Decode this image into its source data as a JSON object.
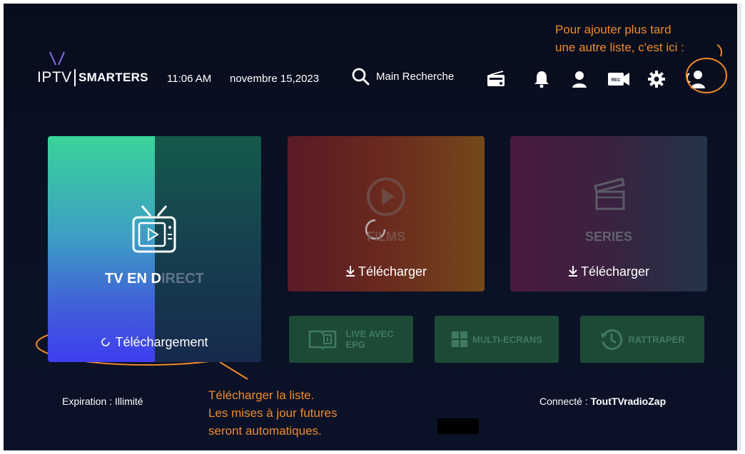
{
  "header": {
    "logo_left": "IPTV",
    "logo_right": "SMARTERS",
    "time": "11:06 AM",
    "date": "novembre 15,2023",
    "search_label": "Main Recherche",
    "icons": [
      "radio-icon",
      "bell-icon",
      "profile-icon",
      "record-icon",
      "gear-icon",
      "switch-user-icon"
    ],
    "record_text": "REC"
  },
  "cards": {
    "live": {
      "title_a": "TV EN D",
      "title_b": "IRECT",
      "status": "Téléchargement"
    },
    "films": {
      "label": "FILMS",
      "action": "Télécharger"
    },
    "series": {
      "label": "SERIES",
      "action": "Télécharger"
    },
    "epg": {
      "line1": "LIVE AVEC",
      "line2": "EPG"
    },
    "multi": {
      "label": "MULTI-ECRANS"
    },
    "catchup": {
      "label": "RATTRAPER"
    }
  },
  "footer": {
    "expiration": "Expiration : Illimité",
    "connected_label": "Connecté :",
    "connected_value": "ToutTVradioZap"
  },
  "annotations": {
    "top_line1": "Pour ajouter plus tard",
    "top_line2": "une autre liste, c'est ici :",
    "bottom_line1": "Télécharger la liste.",
    "bottom_line2": "Les mises à jour futures",
    "bottom_line3": "seront automatiques."
  },
  "colors": {
    "annotation": "#f08a2c",
    "background": "#0a1124"
  }
}
